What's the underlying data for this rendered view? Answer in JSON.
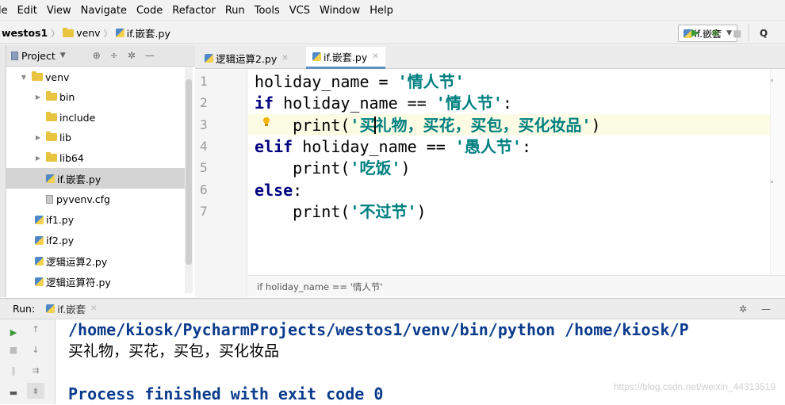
{
  "menu": [
    "le",
    "Edit",
    "View",
    "Navigate",
    "Code",
    "Refactor",
    "Run",
    "Tools",
    "VCS",
    "Window",
    "Help"
  ],
  "navbar": {
    "project": "westos1",
    "folder": "venv",
    "file": "if.嵌套.py"
  },
  "toolbar": {
    "run_config": "if.嵌套",
    "search_icon": "Q"
  },
  "project_panel": {
    "title": "Project",
    "items": [
      {
        "label": "venv",
        "type": "folder",
        "expanded": true
      },
      {
        "label": "bin",
        "type": "folder"
      },
      {
        "label": "include",
        "type": "folder"
      },
      {
        "label": "lib",
        "type": "folder"
      },
      {
        "label": "lib64",
        "type": "folder"
      },
      {
        "label": "if.嵌套.py",
        "type": "py",
        "selected": true
      },
      {
        "label": "pyvenv.cfg",
        "type": "cfg"
      },
      {
        "label": "if1.py",
        "type": "py"
      },
      {
        "label": "if2.py",
        "type": "py"
      },
      {
        "label": "逻辑运算2.py",
        "type": "py"
      },
      {
        "label": "逻辑运算符.py",
        "type": "py"
      }
    ]
  },
  "editor_tabs": [
    {
      "label": "逻辑运算2.py",
      "active": false
    },
    {
      "label": "if.嵌套.py",
      "active": true
    }
  ],
  "editor": {
    "line_numbers": [
      "1",
      "2",
      "3",
      "4",
      "5",
      "6",
      "7"
    ],
    "lines": [
      {
        "a": "holiday_name = ",
        "s": "'情人节'"
      },
      {
        "k": "if",
        "a": " holiday_name == ",
        "s": "'情人节'",
        "z": ":"
      },
      {
        "a": "    print(",
        "s1": "'买",
        "s2": "礼物，买花，买包，买化妆品'",
        "z": ")"
      },
      {
        "k": "elif",
        "a": " holiday_name == ",
        "s": "'愚人节'",
        "z": ":"
      },
      {
        "a": "    print(",
        "s": "'吃饭'",
        "z": ")"
      },
      {
        "k": "else",
        "z": ":"
      },
      {
        "a": "    print(",
        "s": "'不过节'",
        "z": ")"
      }
    ],
    "breadcrumb": "if holiday_name == '情人节'"
  },
  "run_panel": {
    "label": "Run:",
    "tab": "if.嵌套",
    "console": [
      "/home/kiosk/PycharmProjects/westos1/venv/bin/python /home/kiosk/P",
      "买礼物，买花，买包，买化妆品",
      "",
      "Process finished with exit code 0"
    ],
    "watermark": "https://blog.csdn.net/weixin_44313519"
  },
  "colors": {
    "keyword": "#000080",
    "string": "#008080",
    "console_path": "#0b3b8c",
    "current_line": "#fcfbe4"
  }
}
